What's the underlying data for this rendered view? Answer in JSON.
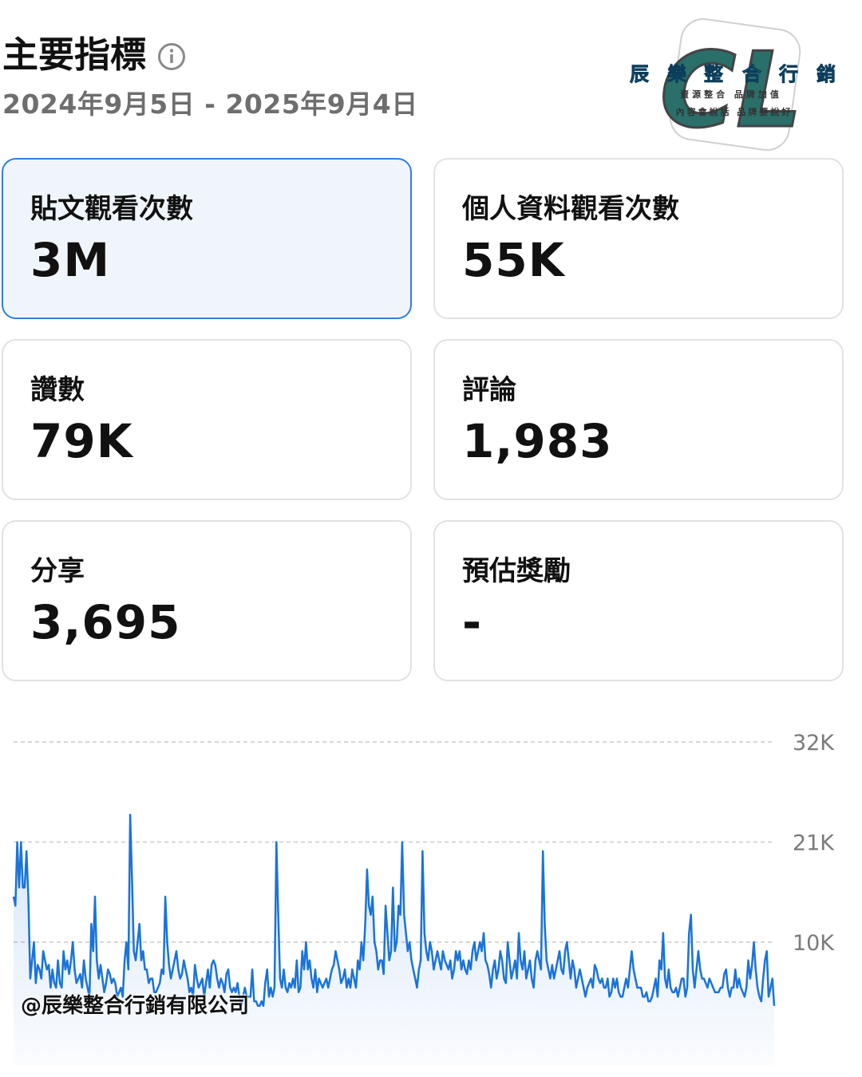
{
  "header": {
    "title": "主要指標",
    "date_range": "2024年9月5日 - 2025年9月4日"
  },
  "logo": {
    "letters": "CL",
    "brand_chars": [
      "辰",
      "樂",
      "整",
      "合",
      "行",
      "銷"
    ],
    "line1": "資源整合 品牌加值",
    "line2": "內容會說話 品牌要說好"
  },
  "metrics": [
    {
      "label": "貼文觀看次數",
      "value": "3M",
      "selected": true
    },
    {
      "label": "個人資料觀看次數",
      "value": "55K",
      "selected": false
    },
    {
      "label": "讚數",
      "value": "79K",
      "selected": false
    },
    {
      "label": "評論",
      "value": "1,983",
      "selected": false
    },
    {
      "label": "分享",
      "value": "3,695",
      "selected": false
    },
    {
      "label": "預估獎勵",
      "value": "-",
      "selected": false
    }
  ],
  "colors": {
    "accent": "#2f7fe0",
    "line": "#1a73d9",
    "grid": "#c9c9c9",
    "tick": "#7a7a7a"
  },
  "watermark": "@辰樂整合行銷有限公司",
  "chart_data": {
    "type": "area",
    "ylim": [
      0,
      32000
    ],
    "yticks": [
      {
        "value": 32000,
        "label": "32K"
      },
      {
        "value": 21000,
        "label": "21K"
      },
      {
        "value": 10000,
        "label": "10K"
      }
    ],
    "grid": "horizontal dashed",
    "series": [
      {
        "values": [
          15000,
          14000,
          21000,
          16000,
          21000,
          16000,
          16000,
          20000,
          15000,
          6000,
          8000,
          10000,
          5500,
          7500,
          7000,
          6000,
          9000,
          8000,
          7000,
          7500,
          5000,
          7000,
          5500,
          5000,
          8000,
          5500,
          5000,
          9000,
          7000,
          8000,
          6500,
          8000,
          10000,
          7000,
          5500,
          6000,
          6500,
          5000,
          8000,
          6000,
          5000,
          4000,
          12000,
          9000,
          15000,
          8000,
          6000,
          7500,
          6000,
          4500,
          5500,
          7000,
          6500,
          5500,
          6000,
          5500,
          4000,
          4500,
          5000,
          4000,
          8000,
          10000,
          7000,
          24000,
          17000,
          9000,
          8000,
          10000,
          12000,
          8000,
          9000,
          7000,
          7000,
          5500,
          6000,
          6000,
          4500,
          4500,
          5000,
          5500,
          7000,
          6500,
          15000,
          10000,
          7500,
          6000,
          7000,
          8000,
          9000,
          7000,
          6000,
          6500,
          8000,
          7000,
          6000,
          4500,
          5000,
          4000,
          7500,
          6000,
          5000,
          5500,
          6000,
          4000,
          5500,
          7000,
          5000,
          7500,
          8000,
          7500,
          6000,
          5000,
          6000,
          5500,
          4500,
          6500,
          7000,
          5000,
          4500,
          5000,
          4500,
          5500,
          4000,
          3000,
          4000,
          5000,
          4000,
          4000,
          4000,
          7000,
          3500,
          3500,
          3000,
          3000,
          3500,
          3000,
          5500,
          7000,
          4000,
          5000,
          4000,
          5000,
          21000,
          13000,
          6000,
          5000,
          7000,
          5000,
          4500,
          5500,
          5000,
          6000,
          5000,
          8000,
          4500,
          5000,
          9000,
          7000,
          10000,
          7000,
          8000,
          6000,
          5000,
          7000,
          4500,
          6000,
          5500,
          5000,
          5500,
          6000,
          5000,
          6000,
          7000,
          7500,
          9000,
          8000,
          7000,
          5500,
          6000,
          7000,
          5000,
          6000,
          5000,
          7000,
          6000,
          5000,
          8000,
          7000,
          10000,
          8000,
          12000,
          18000,
          14000,
          13000,
          15000,
          10000,
          9000,
          7000,
          8000,
          8000,
          6500,
          14000,
          11000,
          8000,
          9000,
          16000,
          9000,
          10000,
          14000,
          13000,
          21000,
          13000,
          11000,
          9000,
          10000,
          8000,
          7000,
          6000,
          5000,
          7000,
          8000,
          20000,
          11000,
          9000,
          8000,
          10000,
          9000,
          7000,
          8000,
          9000,
          8000,
          7000,
          9000,
          8000,
          7500,
          7000,
          8000,
          6000,
          7000,
          9000,
          8000,
          9000,
          7000,
          8000,
          7000,
          6500,
          8000,
          7000,
          9000,
          10000,
          8000,
          9000,
          10000,
          9000,
          11000,
          8000,
          7500,
          6500,
          5000,
          7000,
          8000,
          6000,
          7000,
          9000,
          8000,
          6000,
          5500,
          10000,
          8000,
          6000,
          7000,
          8000,
          6000,
          11000,
          8000,
          7000,
          9000,
          6000,
          7000,
          8000,
          6000,
          5000,
          8000,
          9000,
          8000,
          7000,
          20000,
          12000,
          8000,
          7000,
          6000,
          7500,
          6000,
          7000,
          8000,
          9000,
          7000,
          6500,
          9000,
          10000,
          8000,
          6000,
          8000,
          7000,
          5000,
          6000,
          7000,
          6000,
          5000,
          4000,
          5000,
          5500,
          6000,
          5000,
          7500,
          7000,
          6000,
          5500,
          6000,
          5000,
          5000,
          6000,
          4000,
          4500,
          6000,
          5000,
          6000,
          4500,
          4000,
          4000,
          5000,
          6000,
          5000,
          7000,
          9000,
          7000,
          6000,
          5000,
          5000,
          5000,
          4000,
          4000,
          4500,
          3500,
          3500,
          4000,
          5000,
          6000,
          4000,
          8000,
          7000,
          11000,
          6000,
          5000,
          7000,
          5000,
          4500,
          4500,
          5000,
          4000,
          5000,
          6000,
          6000,
          4000,
          5000,
          11000,
          13000,
          7000,
          5000,
          7000,
          9000,
          7000,
          6000,
          6000,
          5500,
          5000,
          6000,
          5500,
          5000,
          4500,
          4500,
          4500,
          5000,
          5000,
          6500,
          7000,
          5000,
          4000,
          5000,
          5000,
          7000,
          5000,
          6000,
          5000,
          4500,
          4000,
          5000,
          8000,
          6000,
          7500,
          10000,
          7000,
          5000,
          4000,
          3500,
          6000,
          8000,
          9000,
          4000,
          5000,
          6000,
          3000
        ]
      }
    ]
  }
}
